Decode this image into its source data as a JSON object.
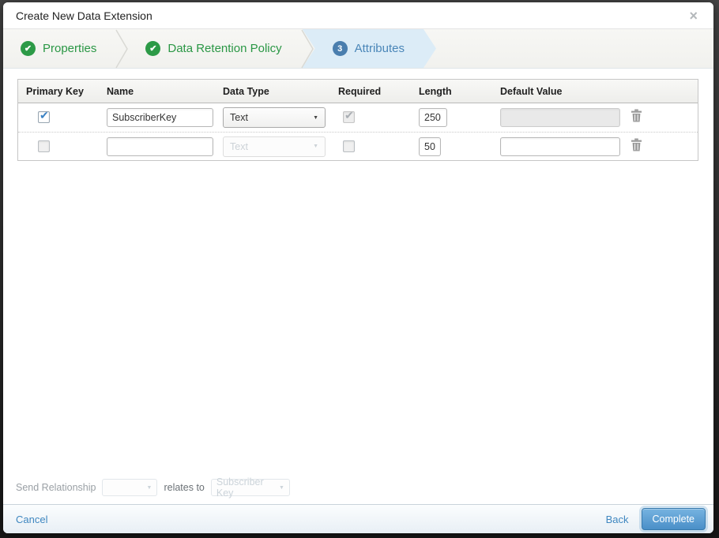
{
  "modal": {
    "title": "Create New Data Extension",
    "close_glyph": "×"
  },
  "wizard": {
    "check_glyph": "✔",
    "steps": [
      {
        "label": "Properties",
        "state": "complete"
      },
      {
        "label": "Data Retention Policy",
        "state": "complete"
      },
      {
        "label": "Attributes",
        "state": "active",
        "number": "3"
      }
    ]
  },
  "attributes_table": {
    "headers": {
      "primary_key": "Primary Key",
      "name": "Name",
      "data_type": "Data Type",
      "required": "Required",
      "length": "Length",
      "default_value": "Default Value"
    },
    "rows": [
      {
        "primary_key": true,
        "name": "SubscriberKey",
        "data_type": "Text",
        "required": true,
        "length": "250",
        "default_value": ""
      },
      {
        "primary_key": false,
        "name": "",
        "data_type": "Text",
        "required": false,
        "length": "50",
        "default_value": ""
      }
    ],
    "dropdown_arrow": "▼"
  },
  "send_relationship": {
    "label": "Send Relationship",
    "relates_to_label": "relates to",
    "relates_to_value": "Subscriber Key",
    "dropdown_arrow": "▼"
  },
  "footer": {
    "cancel_label": "Cancel",
    "back_label": "Back",
    "complete_label": "Complete"
  },
  "colors": {
    "step_complete_green": "#2a9745",
    "step_active_blue": "#4a86b8",
    "step_active_bg": "#dcecf7",
    "accent_blue": "#4a8fc8",
    "checkbox_check_blue": "#3b82c4"
  }
}
